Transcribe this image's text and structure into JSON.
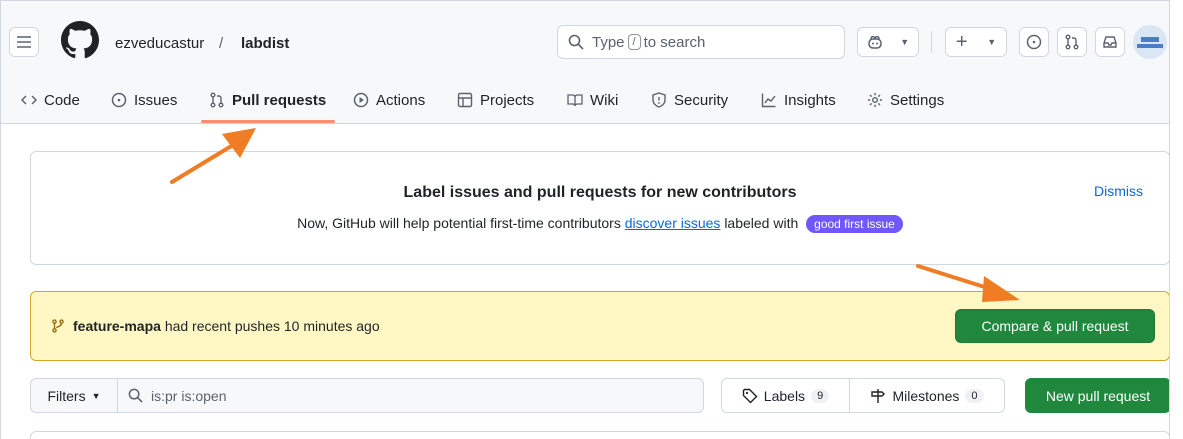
{
  "header": {
    "owner": "ezveducastur",
    "separator": "/",
    "repo": "labdist",
    "search": {
      "prefix": "Type",
      "key": "/",
      "suffix": "to search"
    }
  },
  "tabs": [
    {
      "label": "Code",
      "icon": "code-icon"
    },
    {
      "label": "Issues",
      "icon": "issue-icon"
    },
    {
      "label": "Pull requests",
      "icon": "pull-request-icon",
      "active": true
    },
    {
      "label": "Actions",
      "icon": "play-icon"
    },
    {
      "label": "Projects",
      "icon": "table-icon"
    },
    {
      "label": "Wiki",
      "icon": "book-icon"
    },
    {
      "label": "Security",
      "icon": "shield-icon"
    },
    {
      "label": "Insights",
      "icon": "graph-icon"
    },
    {
      "label": "Settings",
      "icon": "gear-icon"
    }
  ],
  "banner": {
    "title": "Label issues and pull requests for new contributors",
    "text_before": "Now, GitHub will help potential first-time contributors",
    "link": "discover issues",
    "text_after": "labeled with",
    "label": "good first issue",
    "dismiss": "Dismiss"
  },
  "push": {
    "branch": "feature-mapa",
    "message": "had recent pushes 10 minutes ago",
    "button": "Compare & pull request"
  },
  "filters": {
    "button": "Filters",
    "query": "is:pr is:open",
    "labels": "Labels",
    "labels_count": "9",
    "milestones": "Milestones",
    "milestones_count": "0",
    "new_pr": "New pull request"
  },
  "colors": {
    "accent_green": "#1f883d",
    "link_blue": "#0969da",
    "tab_underline": "#fd8c73",
    "arrow": "#f07c24",
    "label_purple": "#7057ff"
  }
}
